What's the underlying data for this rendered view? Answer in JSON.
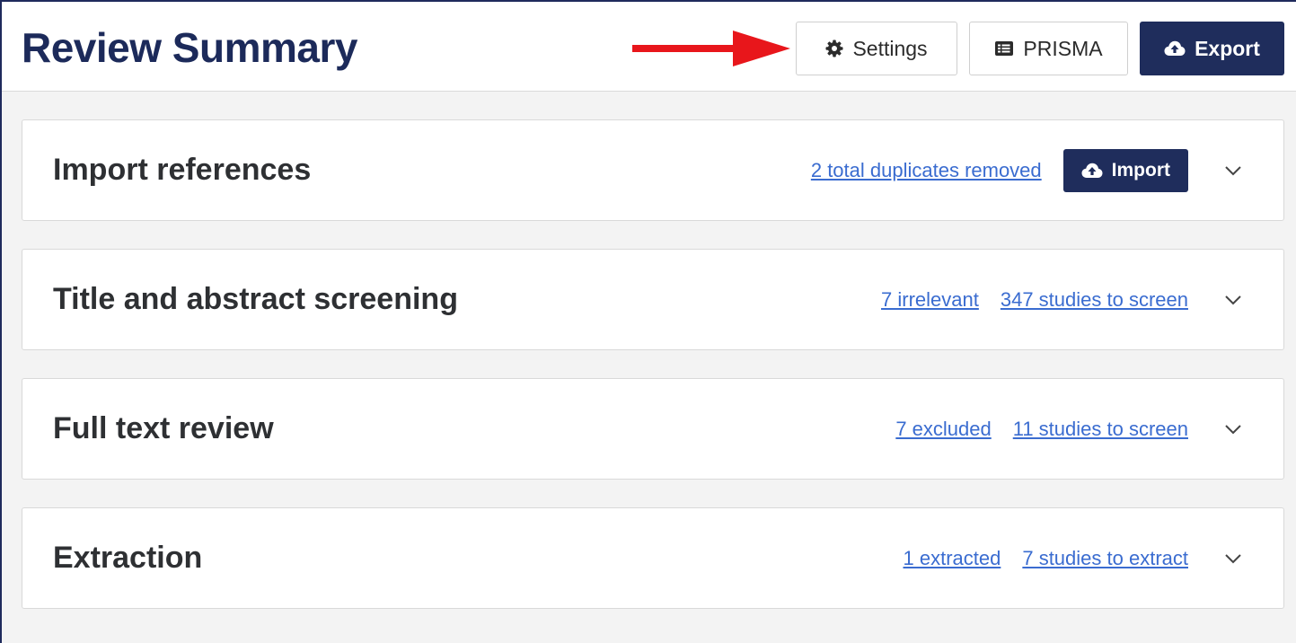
{
  "header": {
    "title": "Review Summary",
    "buttons": {
      "settings_label": "Settings",
      "prisma_label": "PRISMA",
      "export_label": "Export"
    }
  },
  "sections": [
    {
      "title": "Import references",
      "links": [
        "2 total duplicates removed"
      ],
      "action_label": "Import"
    },
    {
      "title": "Title and abstract screening",
      "links": [
        "7 irrelevant",
        "347 studies to screen"
      ]
    },
    {
      "title": "Full text review",
      "links": [
        "7 excluded",
        "11 studies to screen"
      ]
    },
    {
      "title": "Extraction",
      "links": [
        "1 extracted",
        "7 studies to extract"
      ]
    }
  ],
  "colors": {
    "brand_navy": "#1f2d5c",
    "link_blue": "#3a6cd0",
    "annotation_arrow": "#e8161b"
  },
  "icons": {
    "settings": "gear-icon",
    "prisma": "list-icon",
    "export": "cloud-upload-icon",
    "import": "cloud-upload-icon",
    "expand": "chevron-down-icon",
    "annotation": "red-arrow"
  }
}
